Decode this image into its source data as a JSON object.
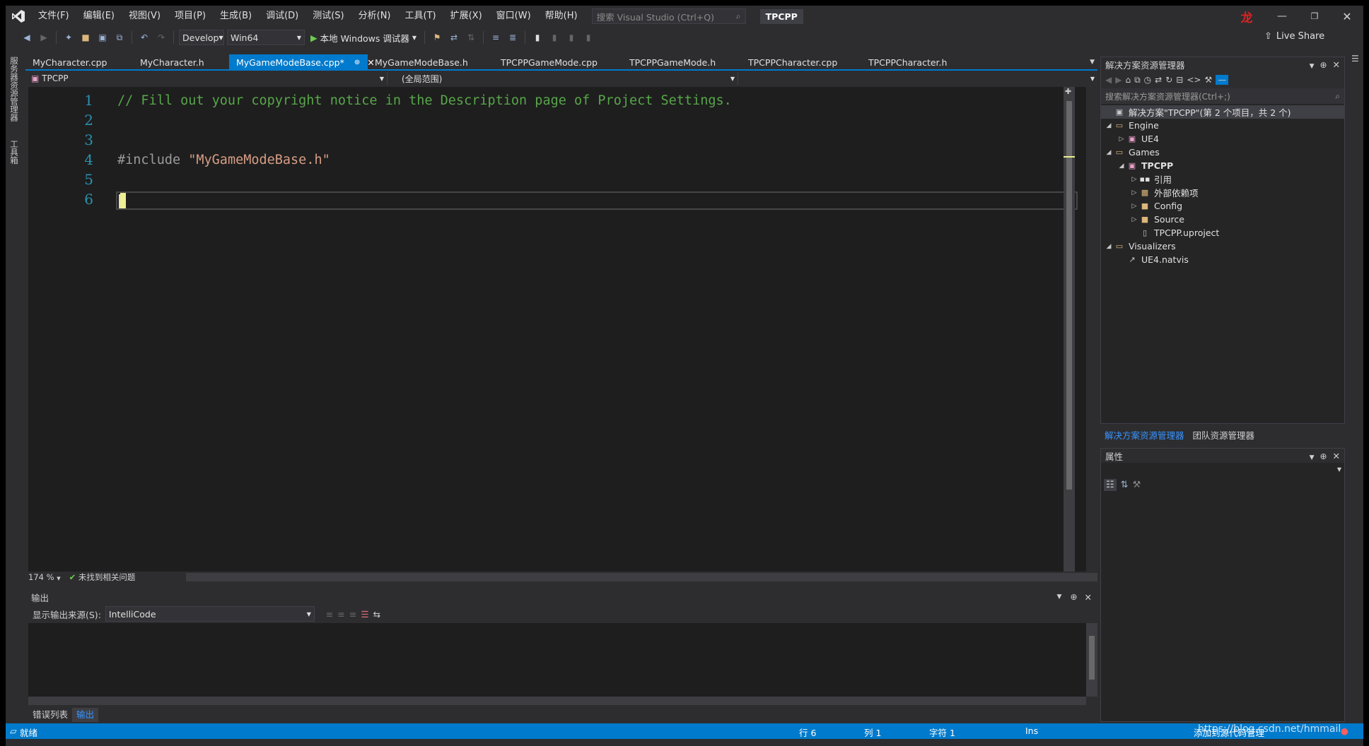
{
  "menu": {
    "items": [
      "文件(F)",
      "编辑(E)",
      "视图(V)",
      "项目(P)",
      "生成(B)",
      "调试(D)",
      "测试(S)",
      "分析(N)",
      "工具(T)",
      "扩展(X)",
      "窗口(W)",
      "帮助(H)"
    ],
    "search_placeholder": "搜索 Visual Studio (Ctrl+Q)",
    "project_title": "TPCPP",
    "avatar_char": "龙"
  },
  "toolbar": {
    "config": "Develop",
    "platform": "Win64",
    "run_label": "本地 Windows 调试器",
    "live_share": "Live Share"
  },
  "left_strip": {
    "tool1": "服务器资源管理器",
    "tool2": "工具箱"
  },
  "tabs": [
    {
      "label": "MyCharacter.cpp"
    },
    {
      "label": "MyCharacter.h"
    },
    {
      "label": "MyGameModeBase.cpp*"
    },
    {
      "label": "MyGameModeBase.h"
    },
    {
      "label": "TPCPPGameMode.cpp"
    },
    {
      "label": "TPCPPGameMode.h"
    },
    {
      "label": "TPCPPCharacter.cpp"
    },
    {
      "label": "TPCPPCharacter.h"
    }
  ],
  "navbar": {
    "project": "TPCPP",
    "scope": "(全局范围)"
  },
  "code": {
    "line_numbers": [
      "1",
      "2",
      "3",
      "4",
      "5",
      "6"
    ],
    "line1": "// Fill out your copyright notice in the Description page of Project Settings.",
    "line4_directive": "#include ",
    "line4_string": "\"MyGameModeBase.h\""
  },
  "editor_status": {
    "zoom": "174 %",
    "issues": "未找到相关问题"
  },
  "output": {
    "title": "输出",
    "source_label": "显示输出来源(S):",
    "source_value": "IntelliCode",
    "tabs": [
      "错误列表",
      "输出"
    ]
  },
  "solution_explorer": {
    "title": "解决方案资源管理器",
    "search_placeholder": "搜索解决方案资源管理器(Ctrl+;)",
    "solution": "解决方案\"TPCPP\"(第 2 个项目，共 2 个)",
    "nodes": [
      "Engine",
      "UE4",
      "Games",
      "TPCPP",
      "引用",
      "外部依赖项",
      "Config",
      "Source",
      "TPCPP.uproject",
      "Visualizers",
      "UE4.natvis"
    ],
    "bottom_tabs": [
      "解决方案资源管理器",
      "团队资源管理器"
    ]
  },
  "properties": {
    "title": "属性"
  },
  "statusbar": {
    "ready": "就绪",
    "row": "行 6",
    "col": "列 1",
    "char": "字符 1",
    "mode": "Ins",
    "source_control": "添加到源代码管理",
    "watermark": "https://blog.csdn.net/hmmail"
  },
  "colors": {
    "accent": "#007acc",
    "comment": "#57a64a",
    "string": "#d69d85",
    "line_number": "#2b91af"
  }
}
